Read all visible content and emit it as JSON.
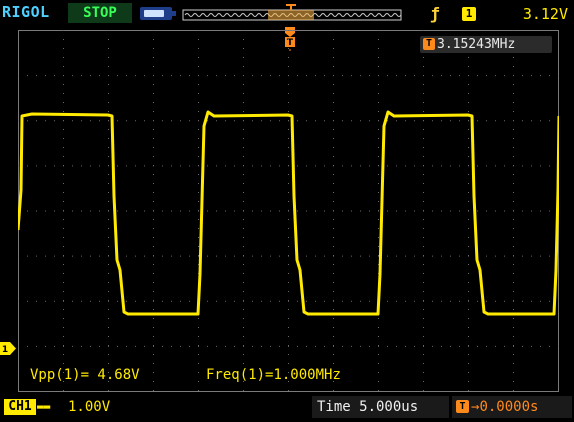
{
  "header": {
    "brand": "RIGOL",
    "run_status": "STOP",
    "trigger_level": "3.12V",
    "trigger_source_badge": "1"
  },
  "frequency_counter": {
    "badge": "T",
    "value": "3.15243MHz"
  },
  "measurements": [
    {
      "label": "Vpp(1)",
      "value": "= 4.68V"
    },
    {
      "label": "Freq(1)",
      "value": "=1.000MHz"
    }
  ],
  "channel_marker": "1",
  "footer": {
    "channel_label": "CH1",
    "channel_scale": "1.00V",
    "timebase": "Time 5.000us",
    "trigger_offset_badge": "T",
    "trigger_offset": "0.0000s"
  },
  "icons": {
    "battery": "battery-icon",
    "trigger_edge": "rising-edge-icon",
    "coupling": "dc-coupling-icon"
  },
  "colors": {
    "trace": "#ffea00",
    "grid": "#5a5a5a",
    "brand": "#4fd0ff",
    "status": "#37ff57",
    "trigger_marker": "#ff8a1c"
  }
}
